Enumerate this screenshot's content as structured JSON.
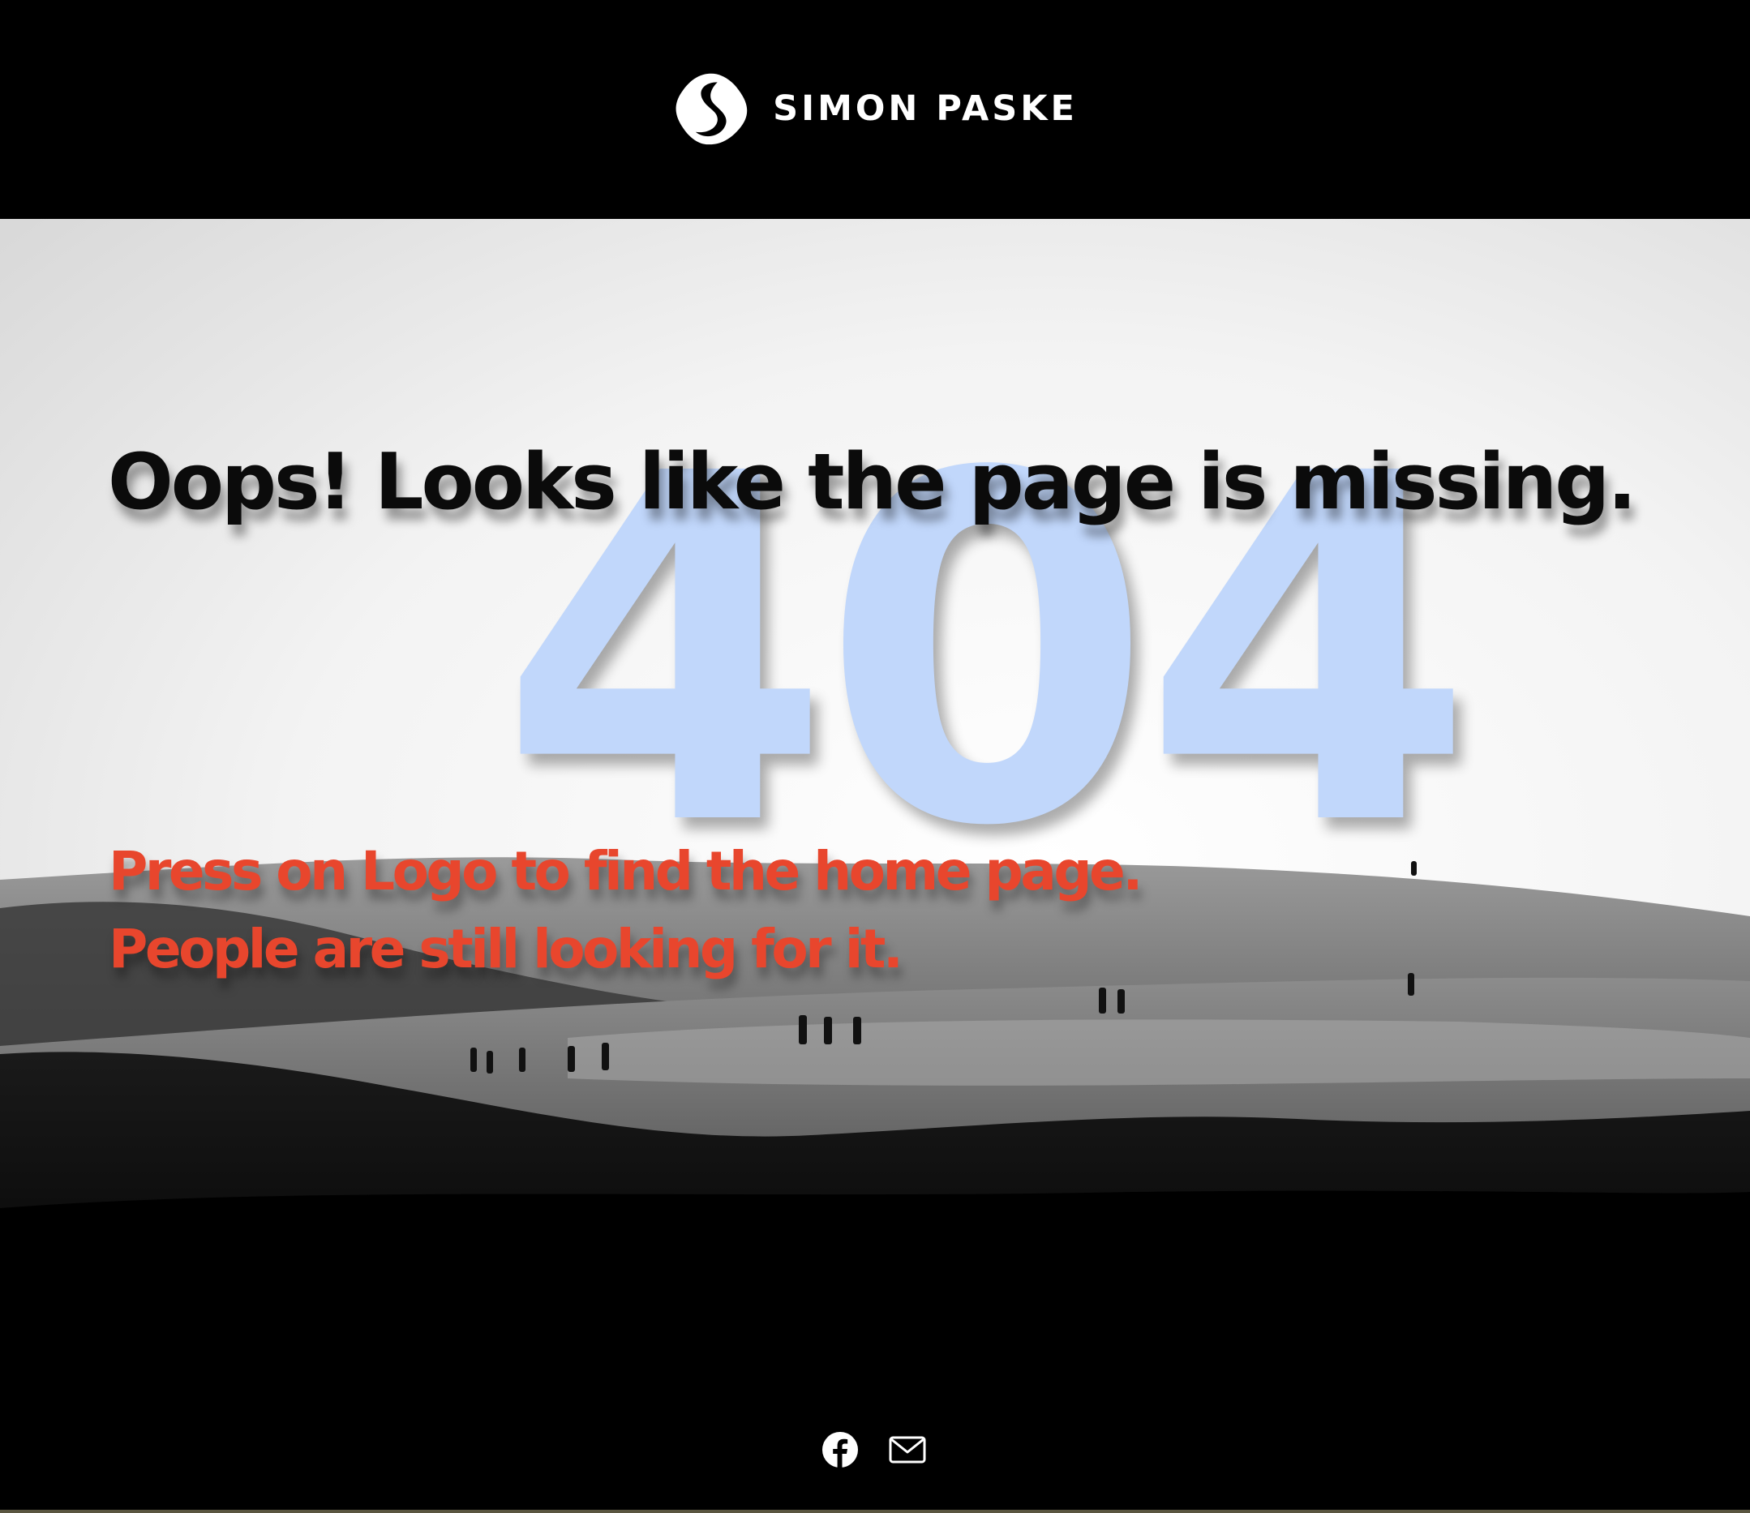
{
  "header": {
    "brand_name": "SIMON PASKE",
    "logo_icon": "s-logo-icon"
  },
  "hero": {
    "big_code": "404",
    "headline": "Oops! Looks like the page is missing.",
    "instruction_line_1": "Press on Logo to find the home page.",
    "instruction_line_2": "People are still looking for it."
  },
  "footer": {
    "social_links": [
      {
        "icon": "facebook-icon"
      },
      {
        "icon": "email-icon"
      }
    ]
  },
  "colors": {
    "header_bg": "#000000",
    "headline": "#0b0b0b",
    "big_code": "#c1d7fb",
    "instructions": "#e8462d",
    "footer_bg": "#000000"
  }
}
